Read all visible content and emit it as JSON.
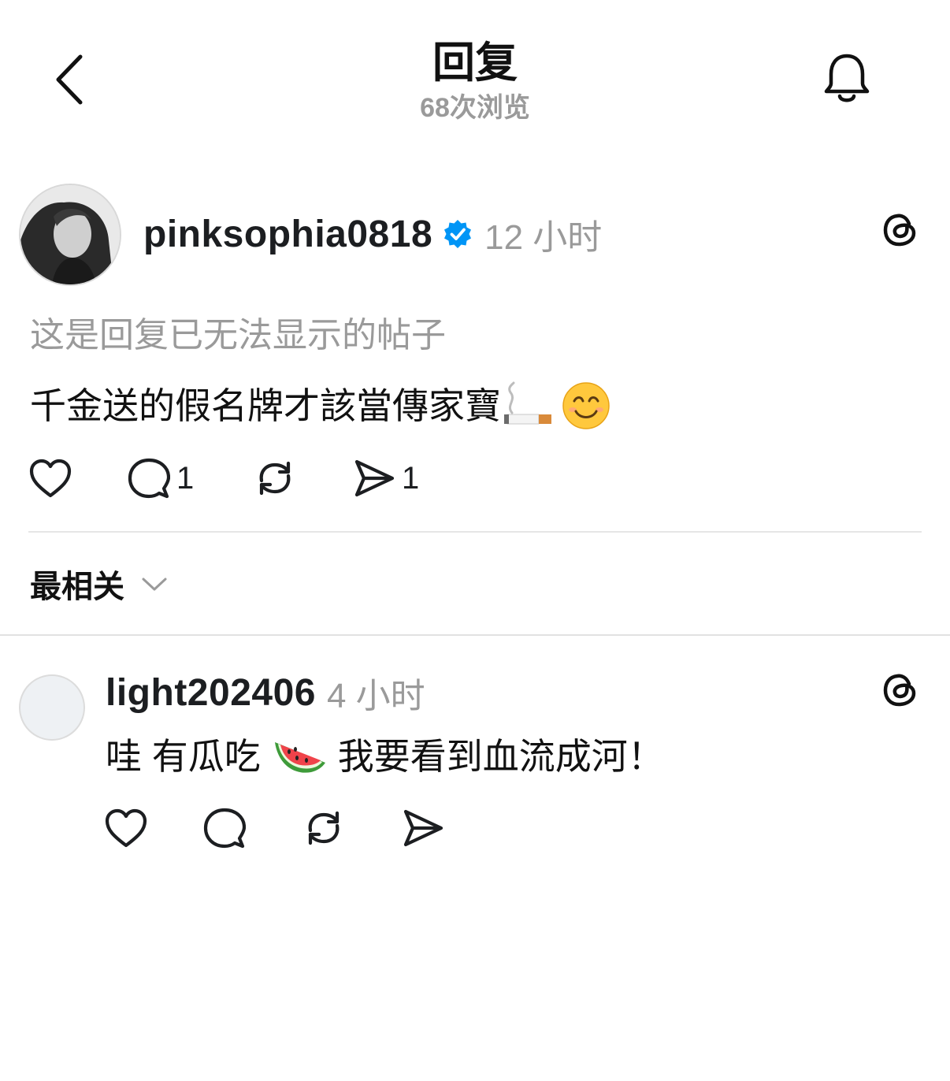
{
  "header": {
    "title": "回复",
    "views": "68次浏览"
  },
  "post": {
    "username": "pinksophia0818",
    "time": "12 小时",
    "notice": "这是回复已无法显示的帖子",
    "text": "千金送的假名牌才該當傳家寶",
    "emojis": [
      "cigarette-emoji",
      "smiling-face-emoji"
    ],
    "replies_count": "1",
    "shares_count": "1"
  },
  "sort": {
    "label": "最相关"
  },
  "reply": {
    "username": "light202406",
    "time": "4 小时",
    "text_before": "哇 有瓜吃",
    "text_after": "我要看到血流成河！",
    "emoji": "watermelon-emoji"
  },
  "colors": {
    "verified": "#0095F6",
    "muted": "#9A9A9A",
    "divider": "#E6E6E6"
  }
}
